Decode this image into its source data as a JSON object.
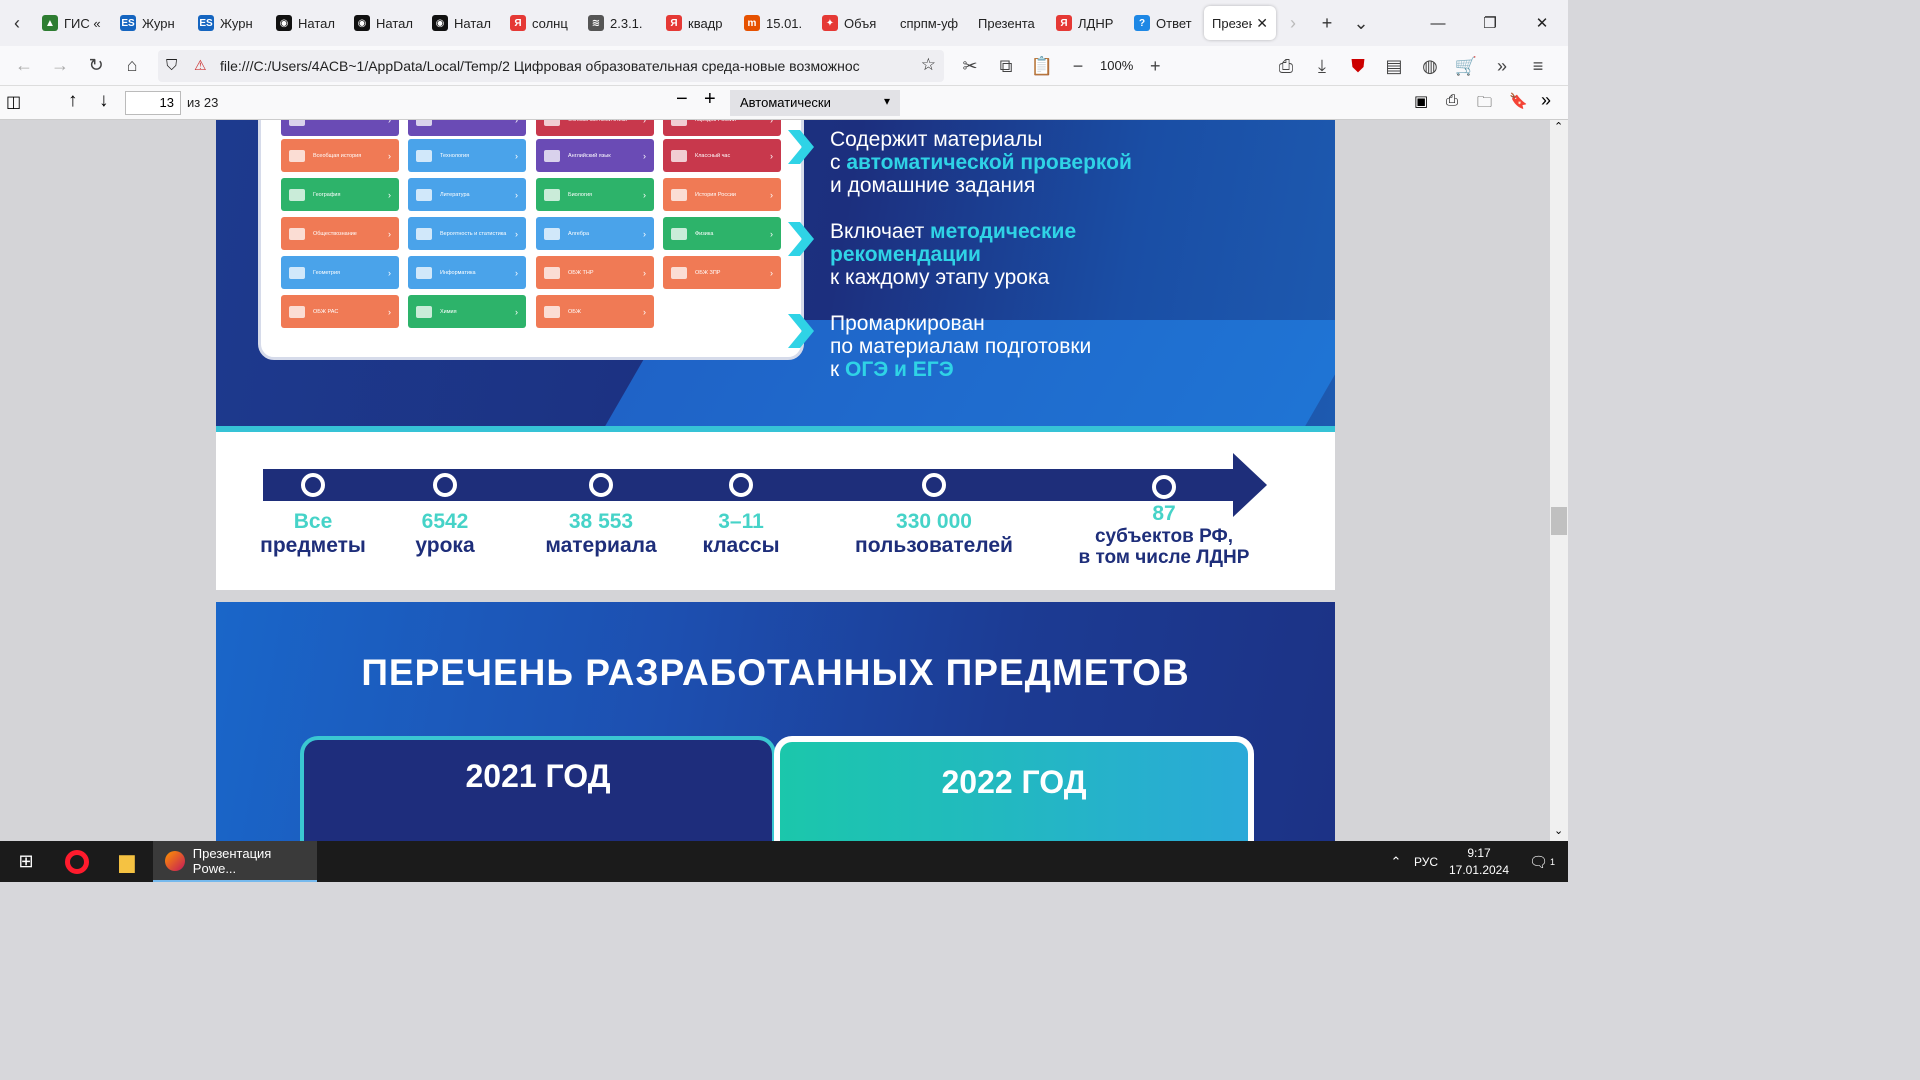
{
  "tabs": [
    {
      "label": "ГИС «",
      "fav": "▲",
      "color": "#2e7d32"
    },
    {
      "label": "Журн",
      "fav": "ES",
      "color": "#1565c0"
    },
    {
      "label": "Журн",
      "fav": "ES",
      "color": "#1565c0"
    },
    {
      "label": "Натал",
      "fav": "◉",
      "color": "#111111"
    },
    {
      "label": "Натал",
      "fav": "◉",
      "color": "#111111"
    },
    {
      "label": "Натал",
      "fav": "◉",
      "color": "#111111"
    },
    {
      "label": "солнц",
      "fav": "Я",
      "color": "#e53935"
    },
    {
      "label": "2.3.1.",
      "fav": "≋",
      "color": "#555555"
    },
    {
      "label": "квадр",
      "fav": "Я",
      "color": "#e53935"
    },
    {
      "label": "15.01.",
      "fav": "m",
      "color": "#e65100"
    },
    {
      "label": "Объя",
      "fav": "✦",
      "color": "#e53935"
    },
    {
      "label": "спрпм-уф",
      "fav": "",
      "color": "#f0f0f4"
    },
    {
      "label": "Презента",
      "fav": "",
      "color": "#f0f0f4"
    },
    {
      "label": "ЛДНР",
      "fav": "Я",
      "color": "#e53935"
    },
    {
      "label": "Ответ",
      "fav": "?",
      "color": "#1e88e5"
    }
  ],
  "active_tab": {
    "label": "Презен"
  },
  "url": "file:///C:/Users/4ACB~1/AppData/Local/Temp/2 Цифровая образовательная среда-новые возможности для",
  "zoom_level": "100%",
  "pdf": {
    "page": "13",
    "of": "из 23",
    "zoom_select": "Автоматически"
  },
  "tiles": [
    {
      "label": "Всеобщая история",
      "color": "#f07a55"
    },
    {
      "label": "Технология",
      "color": "#4aa3ea"
    },
    {
      "label": "Английский язык",
      "color": "#6a4bb5"
    },
    {
      "label": "Классный час",
      "color": "#c8384c"
    },
    {
      "label": "География",
      "color": "#2db36a"
    },
    {
      "label": "Литература",
      "color": "#4aa3ea"
    },
    {
      "label": "Биология",
      "color": "#2db36a"
    },
    {
      "label": "История России",
      "color": "#f07a55"
    },
    {
      "label": "Обществознание",
      "color": "#f07a55"
    },
    {
      "label": "Вероятность и статистика",
      "color": "#4aa3ea"
    },
    {
      "label": "Алгебра",
      "color": "#4aa3ea"
    },
    {
      "label": "Физика",
      "color": "#2db36a"
    },
    {
      "label": "Геометрия",
      "color": "#4aa3ea"
    },
    {
      "label": "Информатика",
      "color": "#4aa3ea"
    },
    {
      "label": "ОБЖ ТНР",
      "color": "#f07a55"
    },
    {
      "label": "ОБЖ ЗПР",
      "color": "#f07a55"
    },
    {
      "label": "ОБЖ РАС",
      "color": "#f07a55"
    },
    {
      "label": "Химия",
      "color": "#2db36a"
    },
    {
      "label": "ОБЖ",
      "color": "#f07a55"
    }
  ],
  "tiles_top": [
    {
      "label": "",
      "color": "#6a4bb5"
    },
    {
      "label": "",
      "color": "#6a4bb5"
    },
    {
      "label": "Основы светской этики",
      "color": "#c8384c"
    },
    {
      "label": "народов России",
      "color": "#c8384c"
    }
  ],
  "bullets": [
    {
      "pre": "Содержит материалы",
      "mid_pre": "с ",
      "hl": "автоматической проверкой",
      "post": "и домашние задания"
    },
    {
      "pre": "Включает ",
      "hl": "методические рекомендации",
      "post": "к каждому этапу урока"
    },
    {
      "pre": "Промаркирован",
      "line2": "по материалам подготовки",
      "mid_pre": "к ",
      "hl": "ОГЭ и ЕГЭ"
    }
  ],
  "stats": [
    {
      "n": "Все",
      "l": "предметы"
    },
    {
      "n": "6542",
      "l": "урока"
    },
    {
      "n": "38 553",
      "l": "материала"
    },
    {
      "n": "3–11",
      "l": "классы"
    },
    {
      "n": "330 000",
      "l": "пользователей"
    },
    {
      "n": "87",
      "l": "субъектов РФ,",
      "l2": "в том числе ЛДНР"
    }
  ],
  "slide3": {
    "title": "ПЕРЕЧЕНЬ РАЗРАБОТАННЫХ ПРЕДМЕТОВ",
    "card1": "2021 ГОД",
    "card2": "2022 ГОД"
  },
  "taskbar": {
    "app_label": "Презентация Powe...",
    "lang": "РУС",
    "time": "9:17",
    "date": "17.01.2024",
    "notif_count": "1"
  }
}
